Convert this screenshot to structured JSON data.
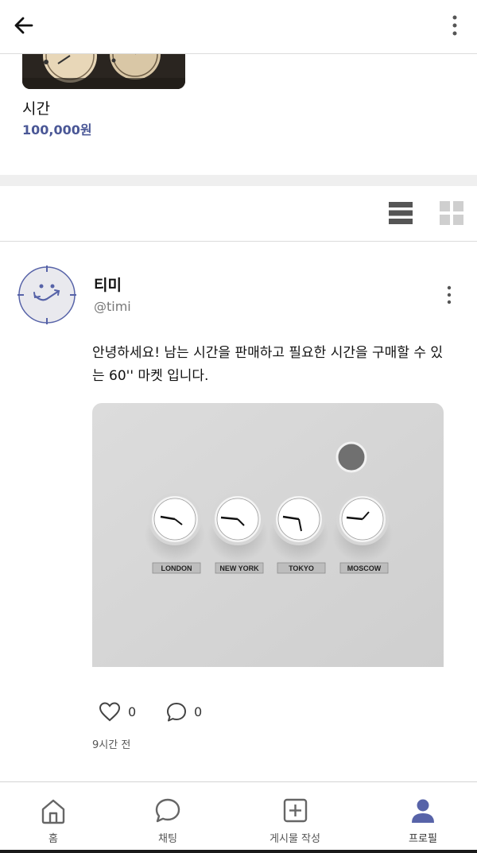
{
  "header": {
    "back_icon": "arrow-left-icon",
    "more_icon": "kebab-vertical-icon"
  },
  "product": {
    "title": "시간",
    "price": "100,000원"
  },
  "view_toggle": {
    "list_icon": "list-view-icon",
    "grid_icon": "grid-view-icon"
  },
  "profile": {
    "name": "티미",
    "handle": "@timi",
    "avatar_icon": "smiley-clock-icon"
  },
  "post": {
    "text": "안녕하세요! 남는 시간을 판매하고 필요한 시간을 구매할 수 있는 60'' 마켓 입니다.",
    "image": {
      "labels": [
        "LONDON",
        "NEW YORK",
        "TOKYO",
        "MOSCOW"
      ]
    },
    "likes": "0",
    "comments": "0",
    "time": "9시간 전"
  },
  "nav": {
    "items": [
      {
        "label": "홈",
        "icon": "home-icon"
      },
      {
        "label": "채팅",
        "icon": "chat-bubble-icon"
      },
      {
        "label": "게시물 작성",
        "icon": "add-post-icon"
      },
      {
        "label": "프로필",
        "icon": "profile-icon"
      }
    ]
  },
  "colors": {
    "accent": "#4a5796",
    "active_nav": "#5763a8"
  }
}
